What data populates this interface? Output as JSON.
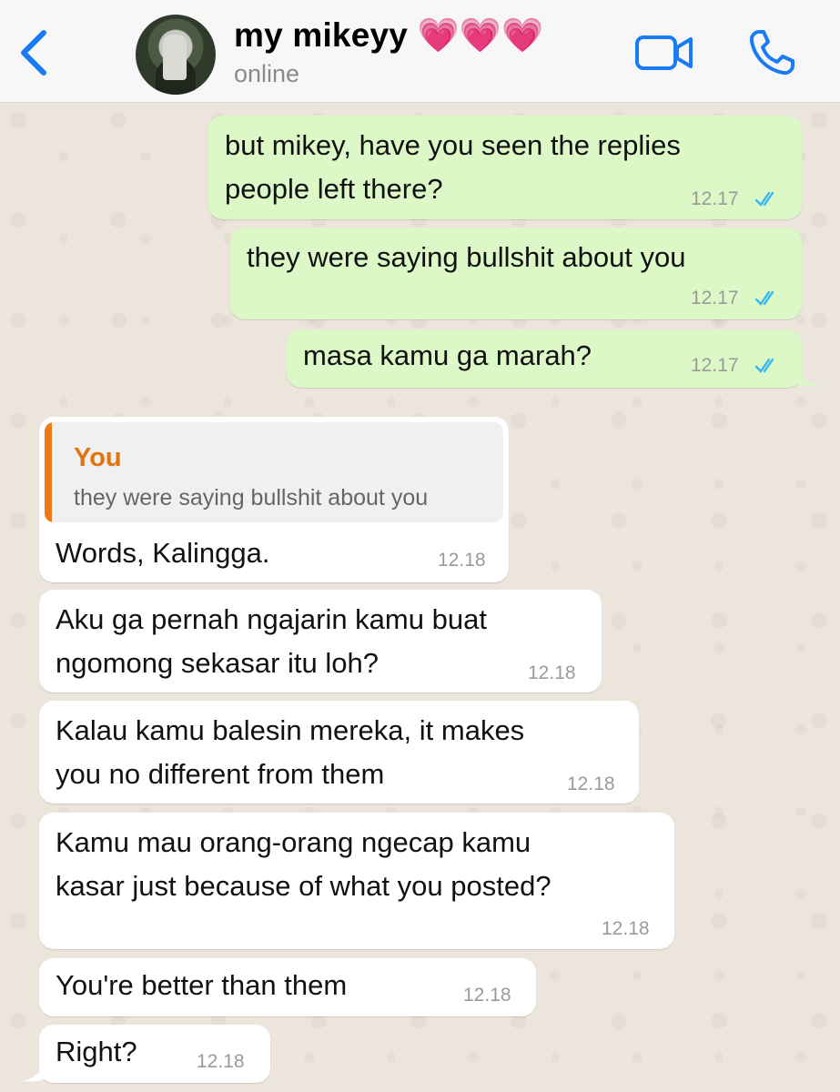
{
  "header": {
    "back_icon": "chevron-left-icon",
    "contact_name": "my mikeyy 💗💗💗",
    "status": "online",
    "video_icon": "video-camera-icon",
    "call_icon": "phone-icon",
    "accent": "#1a7cf5"
  },
  "messages": [
    {
      "dir": "out",
      "lines": [
        "but mikey, have you seen the replies",
        "people left there?"
      ],
      "time": "12.17",
      "read": true
    },
    {
      "dir": "out",
      "lines": [
        "they were saying bullshit about you"
      ],
      "time": "12.17",
      "read": true
    },
    {
      "dir": "out",
      "lines": [
        "masa kamu ga marah?"
      ],
      "time": "12.17",
      "read": true
    },
    {
      "dir": "in",
      "quote": {
        "author": "You",
        "text": "they were saying bullshit about you"
      },
      "lines": [
        "Words, Kalingga."
      ],
      "time": "12.18"
    },
    {
      "dir": "in",
      "lines": [
        "Aku ga pernah ngajarin kamu buat",
        "ngomong sekasar itu loh?"
      ],
      "time": "12.18"
    },
    {
      "dir": "in",
      "lines": [
        "Kalau kamu balesin mereka, it makes",
        "you no different from them"
      ],
      "time": "12.18"
    },
    {
      "dir": "in",
      "lines": [
        "Kamu mau orang-orang ngecap kamu",
        "kasar just because of what you posted?"
      ],
      "time": "12.18"
    },
    {
      "dir": "in",
      "lines": [
        "You're better than them"
      ],
      "time": "12.18"
    },
    {
      "dir": "in",
      "lines": [
        "Right?"
      ],
      "time": "12.18"
    }
  ],
  "colors": {
    "outgoing_bubble": "#dcf8c6",
    "incoming_bubble": "#ffffff",
    "read_ticks": "#34b7f1",
    "quote_accent": "#ec7a15"
  }
}
